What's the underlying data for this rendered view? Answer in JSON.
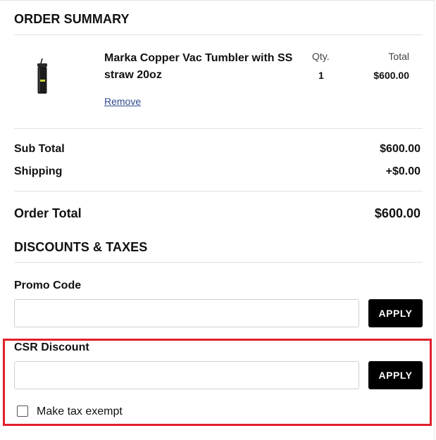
{
  "summary": {
    "title": "ORDER SUMMARY",
    "columns": {
      "qty": "Qty.",
      "total": "Total"
    },
    "item": {
      "name": "Marka Copper Vac Tumbler with SS straw 20oz",
      "qty": "1",
      "total": "$600.00",
      "remove_label": "Remove",
      "image_icon": "tumbler-product-image"
    },
    "sub_total_label": "Sub Total",
    "sub_total_value": "$600.00",
    "shipping_label": "Shipping",
    "shipping_value": "+$0.00",
    "order_total_label": "Order Total",
    "order_total_value": "$600.00"
  },
  "discounts": {
    "title": "DISCOUNTS & TAXES",
    "promo_label": "Promo Code",
    "promo_value": "",
    "promo_apply": "APPLY",
    "csr_label": "CSR Discount",
    "csr_value": "",
    "csr_apply": "APPLY",
    "tax_exempt_label": "Make tax exempt",
    "tax_exempt_checked": false
  },
  "colors": {
    "highlight": "#e0202b",
    "button": "#000000",
    "link": "#2f4a8c"
  }
}
